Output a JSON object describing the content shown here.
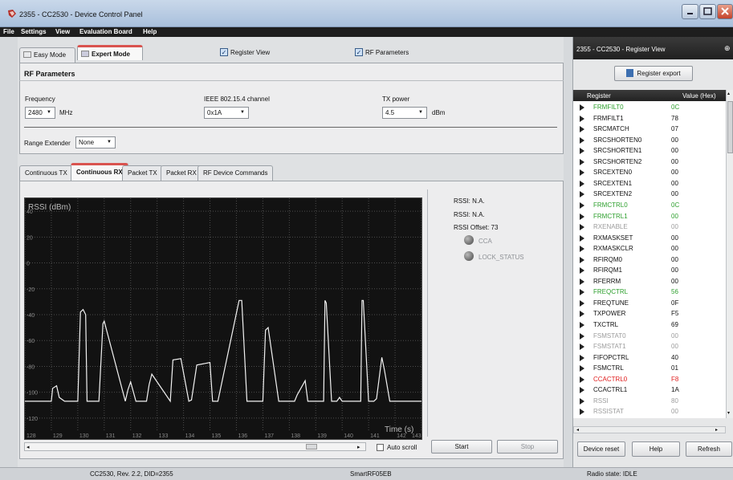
{
  "window": {
    "title": "2355 - CC2530 - Device Control Panel"
  },
  "menu": [
    "File",
    "Settings",
    "View",
    "Evaluation Board",
    "Help"
  ],
  "mode_tabs": {
    "easy": "Easy Mode",
    "expert": "Expert Mode"
  },
  "checkboxes": {
    "register_view": "Register View",
    "rf_parameters": "RF Parameters"
  },
  "rf": {
    "heading": "RF Parameters",
    "frequency_label": "Frequency",
    "frequency_value": "2480",
    "frequency_unit": "MHz",
    "channel_label": "IEEE 802.15.4 channel",
    "channel_value": "0x1A",
    "tx_label": "TX power",
    "tx_value": "4.5",
    "tx_unit": "dBm",
    "range_label": "Range Extender",
    "range_value": "None"
  },
  "func_tabs": [
    "Continuous TX",
    "Continuous RX",
    "Packet TX",
    "Packet RX",
    "RF Device Commands"
  ],
  "rssi_info": {
    "rssi1": "RSSI: N.A.",
    "rssi2": "RSSI: N.A.",
    "offset": "RSSI Offset: 73",
    "cca": "CCA",
    "lock": "LOCK_STATUS"
  },
  "controls": {
    "auto_scroll": "Auto scroll",
    "start": "Start",
    "stop": "Stop"
  },
  "chart_data": {
    "type": "line",
    "title": "RSSI (dBm)",
    "xlabel": "Time (s)",
    "ylabel": "",
    "xlim": [
      128,
      143
    ],
    "ylim": [
      -130,
      50
    ],
    "yticks": [
      40,
      20,
      0,
      -20,
      -40,
      -60,
      -80,
      -100,
      -120
    ],
    "xticks": [
      128,
      129,
      130,
      131,
      132,
      133,
      134,
      135,
      136,
      137,
      138,
      139,
      140,
      141,
      142,
      143
    ],
    "grid": true,
    "series": [
      {
        "x": [
          128,
          129,
          129.05,
          129.2,
          129.3,
          129.5,
          130,
          130.1,
          130.2,
          130.3,
          130.35,
          130.4,
          130.6,
          130.8,
          130.95,
          131,
          131.8,
          131.9,
          132.0,
          132.2,
          132.6,
          132.7,
          132.8,
          133.5,
          133.6,
          133.9,
          134.2,
          134.3,
          134.5,
          135.0,
          135.1,
          135.3,
          136.1,
          136.2,
          136.4,
          137.0,
          137.1,
          137.2,
          137.6,
          137.8,
          138.2,
          138.3,
          138.6,
          138.7,
          139.3,
          139.35,
          139.4,
          139.6,
          139.8,
          139.9,
          140.0,
          140.1,
          140.7,
          140.75,
          140.8,
          141.0,
          141.2,
          141.3,
          141.5,
          141.6,
          141.8,
          142.5,
          143
        ],
        "values": [
          -107,
          -107,
          -97,
          -95,
          -104,
          -107,
          -107,
          -38,
          -36,
          -40,
          -107,
          -107,
          -107,
          -107,
          -47,
          -45,
          -107,
          -98,
          -92,
          -107,
          -107,
          -94,
          -86,
          -107,
          -75,
          -74,
          -107,
          -106,
          -79,
          -77,
          -107,
          -107,
          -29,
          -29,
          -107,
          -107,
          -52,
          -50,
          -107,
          -107,
          -107,
          -102,
          -91,
          -107,
          -107,
          -29,
          -31,
          -107,
          -107,
          -104,
          -107,
          -107,
          -107,
          -29,
          -29,
          -107,
          -107,
          -105,
          -73,
          -83,
          -107,
          -107,
          -107
        ]
      }
    ]
  },
  "register_view": {
    "title": "2355 - CC2530 - Register View",
    "export_label": "Register export",
    "col_register": "Register",
    "col_value": "Value (Hex)",
    "rows": [
      {
        "name": "FRMFILT0",
        "value": "0C",
        "color": "#2ea02e"
      },
      {
        "name": "FRMFILT1",
        "value": "78",
        "color": "#111111"
      },
      {
        "name": "SRCMATCH",
        "value": "07",
        "color": "#111111"
      },
      {
        "name": "SRCSHORTEN0",
        "value": "00",
        "color": "#111111"
      },
      {
        "name": "SRCSHORTEN1",
        "value": "00",
        "color": "#111111"
      },
      {
        "name": "SRCSHORTEN2",
        "value": "00",
        "color": "#111111"
      },
      {
        "name": "SRCEXTEN0",
        "value": "00",
        "color": "#111111"
      },
      {
        "name": "SRCEXTEN1",
        "value": "00",
        "color": "#111111"
      },
      {
        "name": "SRCEXTEN2",
        "value": "00",
        "color": "#111111"
      },
      {
        "name": "FRMCTRL0",
        "value": "0C",
        "color": "#2ea02e"
      },
      {
        "name": "FRMCTRL1",
        "value": "00",
        "color": "#2ea02e"
      },
      {
        "name": "RXENABLE",
        "value": "00",
        "color": "#9c9c9c"
      },
      {
        "name": "RXMASKSET",
        "value": "00",
        "color": "#111111"
      },
      {
        "name": "RXMASKCLR",
        "value": "00",
        "color": "#111111"
      },
      {
        "name": "RFIRQM0",
        "value": "00",
        "color": "#111111"
      },
      {
        "name": "RFIRQM1",
        "value": "00",
        "color": "#111111"
      },
      {
        "name": "RFERRM",
        "value": "00",
        "color": "#111111"
      },
      {
        "name": "FREQCTRL",
        "value": "56",
        "color": "#2ea02e"
      },
      {
        "name": "FREQTUNE",
        "value": "0F",
        "color": "#111111"
      },
      {
        "name": "TXPOWER",
        "value": "F5",
        "color": "#111111"
      },
      {
        "name": "TXCTRL",
        "value": "69",
        "color": "#111111"
      },
      {
        "name": "FSMSTAT0",
        "value": "00",
        "color": "#9c9c9c"
      },
      {
        "name": "FSMSTAT1",
        "value": "00",
        "color": "#9c9c9c"
      },
      {
        "name": "FIFOPCTRL",
        "value": "40",
        "color": "#111111"
      },
      {
        "name": "FSMCTRL",
        "value": "01",
        "color": "#111111"
      },
      {
        "name": "CCACTRL0",
        "value": "F8",
        "color": "#e02020"
      },
      {
        "name": "CCACTRL1",
        "value": "1A",
        "color": "#111111"
      },
      {
        "name": "RSSI",
        "value": "80",
        "color": "#9c9c9c"
      },
      {
        "name": "RSSISTAT",
        "value": "00",
        "color": "#9c9c9c"
      }
    ],
    "buttons": {
      "device_reset": "Device reset",
      "help": "Help",
      "refresh": "Refresh"
    }
  },
  "status": {
    "chip": "CC2530, Rev. 2.2, DID=2355",
    "board": "SmartRF05EB",
    "radio": "Radio state: IDLE"
  }
}
